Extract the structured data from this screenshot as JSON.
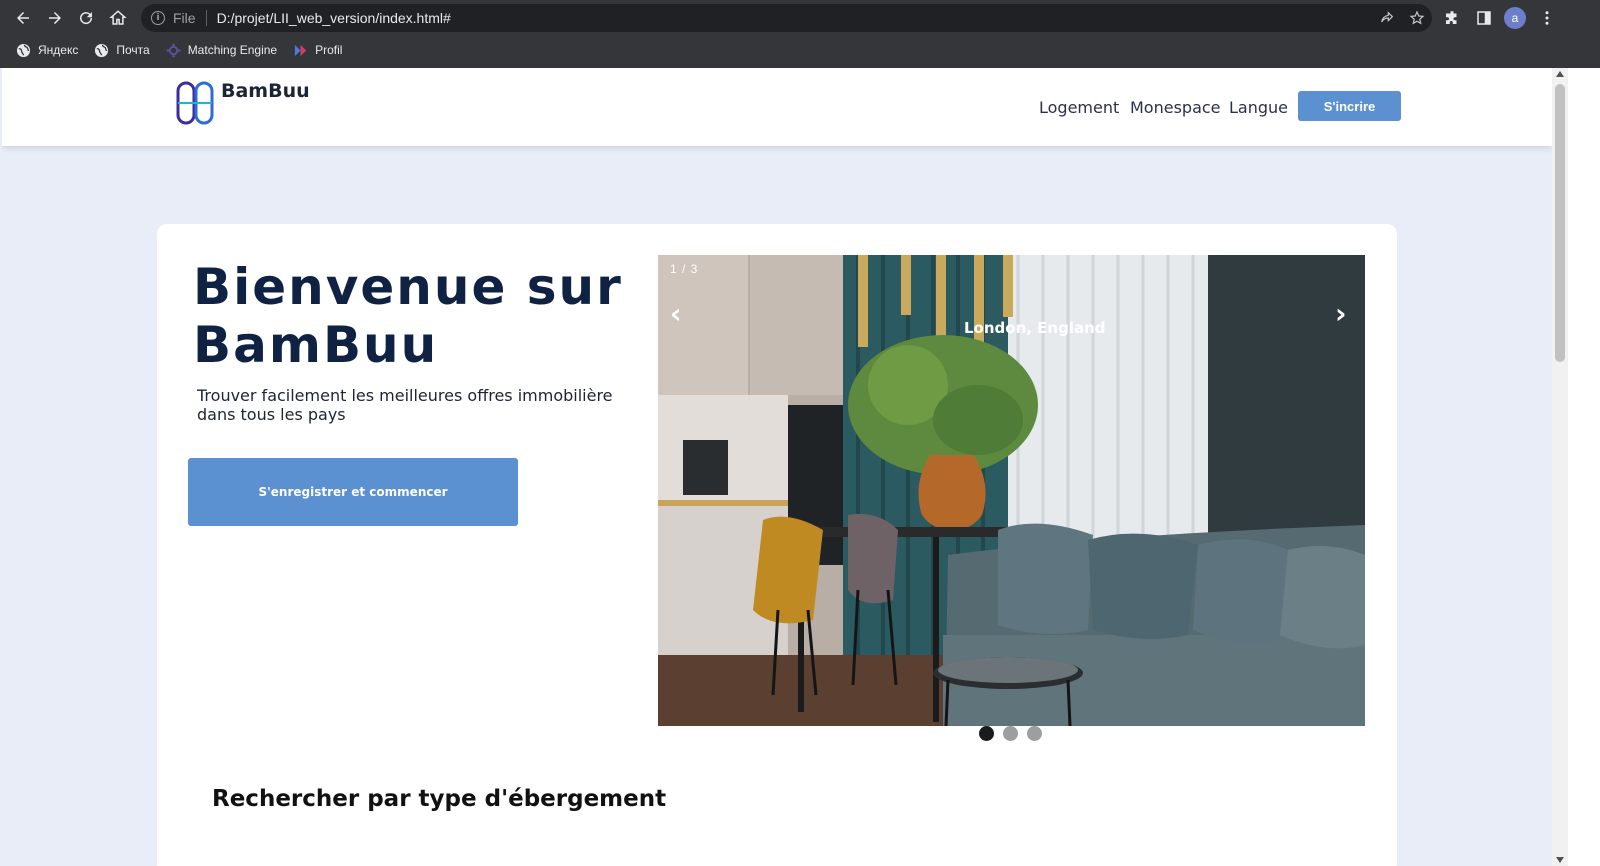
{
  "browser": {
    "url_scheme_label": "File",
    "url": "D:/projet/LII_web_version/index.html#",
    "profile_initial": "a",
    "bookmarks": [
      {
        "label": "Яндекс",
        "icon": "globe-icon"
      },
      {
        "label": "Почта",
        "icon": "globe-icon"
      },
      {
        "label": "Matching Engine",
        "icon": "matching-engine-icon"
      },
      {
        "label": "Profil",
        "icon": "profil-icon"
      }
    ]
  },
  "header": {
    "brand": "BamBuu",
    "nav": [
      "Logement",
      "Monespace",
      "Langue"
    ],
    "signup_label": "S'incrire"
  },
  "hero": {
    "title": "Bienvenue sur BamBuu",
    "subtitle": "Trouver facilement les meilleures offres immobilière dans tous les pays",
    "cta_label": "S'enregistrer et commencer"
  },
  "carousel": {
    "counter": "1 / 3",
    "caption": "London, England",
    "prev": "‹",
    "next": "›",
    "slides": 3,
    "active_slide": 1
  },
  "section": {
    "title": "Rechercher par type d'ébergement"
  },
  "colors": {
    "accent": "#5b91d1",
    "title": "#0f2243",
    "page_bg": "#e8edf7"
  }
}
